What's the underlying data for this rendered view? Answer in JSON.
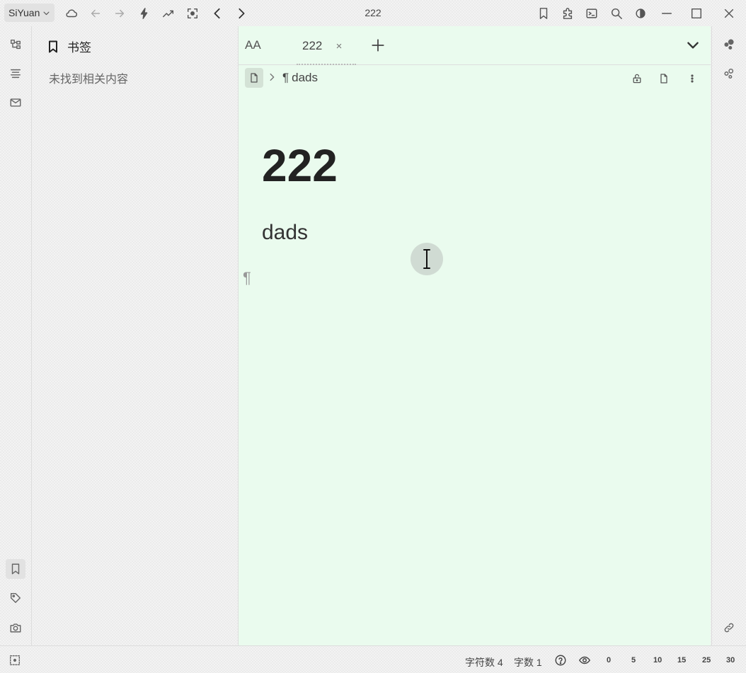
{
  "topbar": {
    "workspace_label": "SiYuan",
    "window_title": "222"
  },
  "bookmark_panel": {
    "title": "书签",
    "empty_text": "未找到相关内容"
  },
  "editor": {
    "font_button_label": "AA",
    "tabs": [
      {
        "title": "222",
        "close_label": "×"
      }
    ],
    "breadcrumb": {
      "pilcrow": "¶",
      "item_label": "dads"
    },
    "document": {
      "title": "222",
      "paragraph": "dads",
      "pilcrow_mark": "¶"
    }
  },
  "statusbar": {
    "char_count": "字符数 4",
    "word_count": "字数 1",
    "zoom_steps": [
      "0",
      "5",
      "10",
      "15",
      "25",
      "30"
    ]
  }
}
